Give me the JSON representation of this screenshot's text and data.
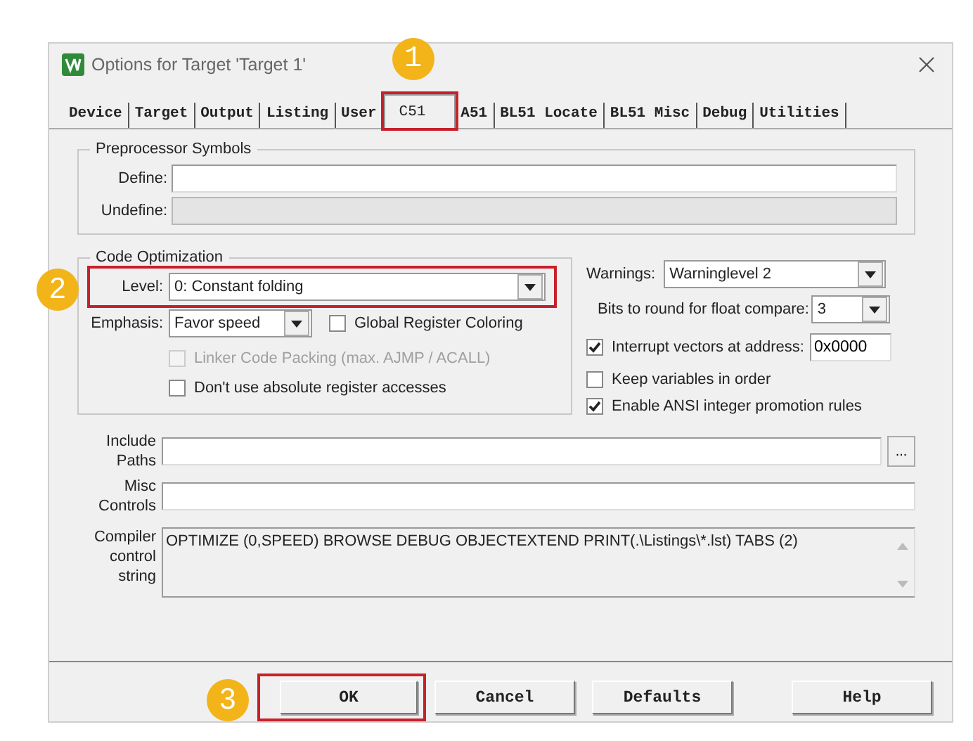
{
  "window": {
    "title": "Options for Target 'Target 1'"
  },
  "tabs": [
    {
      "label": "Device",
      "selected": false
    },
    {
      "label": "Target",
      "selected": false
    },
    {
      "label": "Output",
      "selected": false
    },
    {
      "label": "Listing",
      "selected": false
    },
    {
      "label": "User",
      "selected": false
    },
    {
      "label": "C51",
      "selected": true,
      "callout": "1"
    },
    {
      "label": "A51",
      "selected": false
    },
    {
      "label": "BL51 Locate",
      "selected": false
    },
    {
      "label": "BL51 Misc",
      "selected": false
    },
    {
      "label": "Debug",
      "selected": false
    },
    {
      "label": "Utilities",
      "selected": false
    }
  ],
  "preprocessor": {
    "title": "Preprocessor Symbols",
    "fields": [
      {
        "label": "Define:",
        "disabled": false
      },
      {
        "label": "Undefine:",
        "disabled": true
      }
    ]
  },
  "code_optimization": {
    "title": "Code Optimization",
    "level": {
      "label": "Level:",
      "value": "0: Constant folding",
      "callout": "2"
    },
    "emphasis": {
      "label": "Emphasis:",
      "value": "Favor speed"
    },
    "global_register_coloring": {
      "label": "Global Register Coloring",
      "checked": false,
      "disabled": false
    },
    "options": [
      {
        "label": "Linker Code Packing (max. AJMP / ACALL)",
        "checked": false,
        "disabled": true
      },
      {
        "label": "Don't use absolute register accesses",
        "checked": false,
        "disabled": false
      }
    ]
  },
  "warnings": {
    "label": "Warnings:",
    "value": "Warninglevel 2"
  },
  "float_compare": {
    "label": "Bits to round for float compare:",
    "value": "3"
  },
  "right_options": [
    {
      "label": "Interrupt vectors at address:",
      "checked": true,
      "value": "0x0000"
    },
    {
      "label": "Keep variables in order",
      "checked": false
    },
    {
      "label": "Enable ANSI integer promotion rules",
      "checked": true
    }
  ],
  "include_paths": {
    "label": "Include Paths",
    "button": "..."
  },
  "misc_controls": {
    "label": "Misc Controls"
  },
  "compiler_string": {
    "label": "Compiler control string",
    "value": "OPTIMIZE (0,SPEED) BROWSE DEBUG OBJECTEXTEND PRINT(.\\Listings\\*.lst) TABS (2)"
  },
  "buttons": [
    {
      "label": "OK",
      "callout": "3"
    },
    {
      "label": "Cancel"
    },
    {
      "label": "Defaults"
    },
    {
      "label": "Help"
    }
  ]
}
